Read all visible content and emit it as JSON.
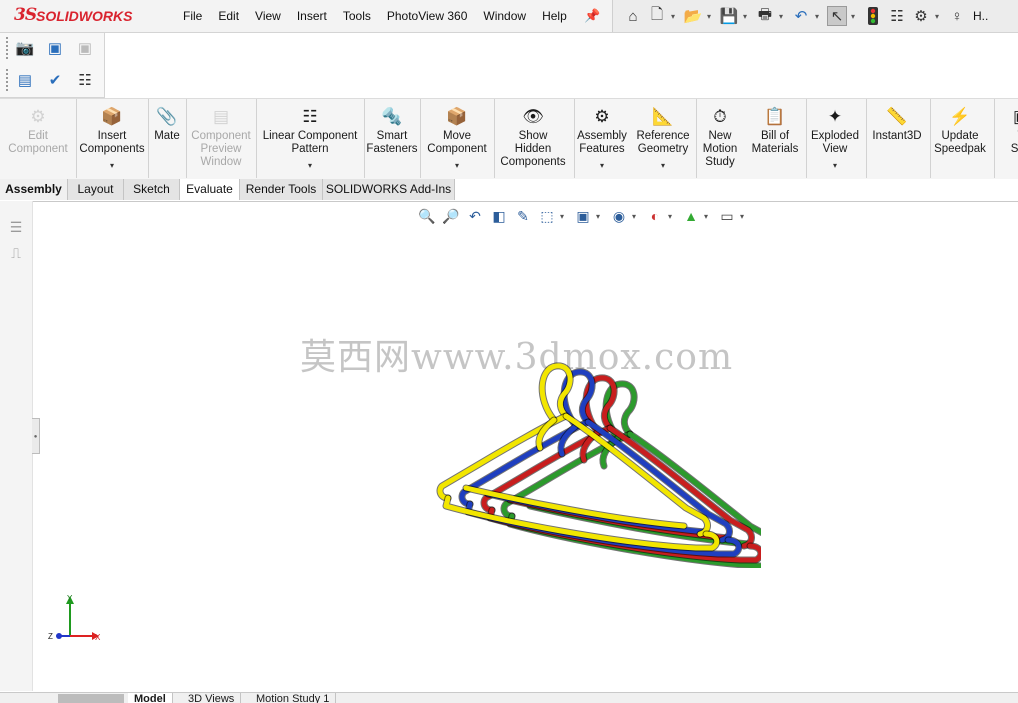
{
  "app": {
    "logo_prefix": "3S",
    "logo_text": "SOLIDWORKS",
    "menu": [
      "File",
      "Edit",
      "View",
      "Insert",
      "Tools",
      "PhotoView 360",
      "Window",
      "Help"
    ],
    "user_label": "H.."
  },
  "quick_access": {
    "icons": [
      "home-icon",
      "new-document-icon",
      "open-folder-icon",
      "save-icon",
      "print-icon",
      "undo-icon",
      "select-pointer-icon",
      "traffic-light-icon",
      "file-properties-icon",
      "options-gear-icon",
      "user-help-icon"
    ]
  },
  "ribbon": {
    "commands": [
      {
        "label": "Edit\nComponent",
        "disabled": true,
        "arrow": false
      },
      {
        "label": "Insert\nComponents",
        "disabled": false,
        "arrow": true
      },
      {
        "label": "Mate",
        "disabled": false,
        "arrow": false
      },
      {
        "label": "Component\nPreview\nWindow",
        "disabled": true,
        "arrow": false
      },
      {
        "label": "Linear Component\nPattern",
        "disabled": false,
        "arrow": true
      },
      {
        "label": "Smart\nFasteners",
        "disabled": false,
        "arrow": false
      },
      {
        "label": "Move\nComponent",
        "disabled": false,
        "arrow": true
      },
      {
        "label": "Show\nHidden\nComponents",
        "disabled": false,
        "arrow": false
      },
      {
        "label": "Assembly\nFeatures",
        "disabled": false,
        "arrow": true
      },
      {
        "label": "Reference\nGeometry",
        "disabled": false,
        "arrow": true
      },
      {
        "label": "New\nMotion\nStudy",
        "disabled": false,
        "arrow": false
      },
      {
        "label": "Bill of\nMaterials",
        "disabled": false,
        "arrow": false
      },
      {
        "label": "Exploded\nView",
        "disabled": false,
        "arrow": true
      },
      {
        "label": "Instant3D",
        "disabled": false,
        "arrow": false
      },
      {
        "label": "Update\nSpeedpak",
        "disabled": false,
        "arrow": false
      },
      {
        "label": "T\nSna",
        "disabled": false,
        "arrow": false
      }
    ]
  },
  "tabs": [
    "Assembly",
    "Layout",
    "Sketch",
    "Evaluate",
    "Render Tools",
    "SOLIDWORKS Add-Ins"
  ],
  "active_tab": "Assembly",
  "view_toolbar": {
    "icons": [
      "zoom-to-fit-icon",
      "zoom-to-area-icon",
      "previous-view-icon",
      "section-view-icon",
      "dynamic-annotation-icon",
      "view-orientation-icon",
      "display-style-icon",
      "hide-show-items-icon",
      "edit-appearance-icon",
      "apply-scene-icon",
      "view-settings-icon"
    ]
  },
  "watermark": "莫西网www.3dmox.com",
  "model": {
    "hanger_colors": [
      "#f2e600",
      "#1f3fbf",
      "#c81e1e",
      "#2c9a2c"
    ]
  },
  "triad": {
    "y_label": "Y",
    "x_label": "X",
    "z_label": "Z"
  },
  "bottom_tabs": [
    "Model",
    "3D Views",
    "Motion Study 1"
  ]
}
